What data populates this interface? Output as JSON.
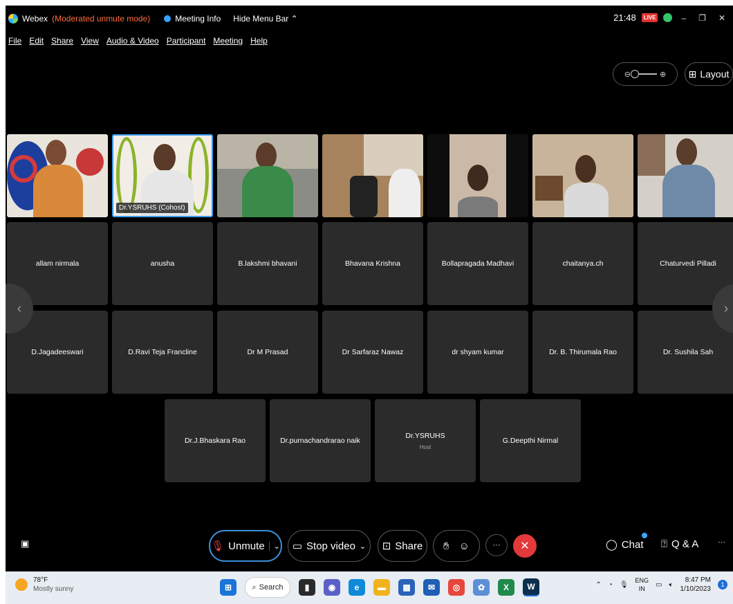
{
  "titlebar": {
    "app_name": "Webex",
    "mode": "(Moderated unmute mode)",
    "meeting_info": "Meeting Info",
    "hide_menu": "Hide Menu Bar ⌃",
    "time": "21:48",
    "rec_badge": "LIVE"
  },
  "menu": [
    "File",
    "Edit",
    "Share",
    "View",
    "Audio & Video",
    "Participant",
    "Meeting",
    "Help"
  ],
  "toolbar": {
    "layout_label": "Layout"
  },
  "video_strip": {
    "host_name_tag": "Dr.YSRUHS (Cohost)"
  },
  "participants": [
    {
      "name": "allam nirmala",
      "role": ""
    },
    {
      "name": "anusha",
      "role": ""
    },
    {
      "name": "B.lakshmi bhavani",
      "role": ""
    },
    {
      "name": "Bhavana Krishna",
      "role": ""
    },
    {
      "name": "Bollapragada Madhavi",
      "role": ""
    },
    {
      "name": "chaitanya.ch",
      "role": ""
    },
    {
      "name": "Chaturvedi Pilladi",
      "role": ""
    },
    {
      "name": "D.Jagadeeswari",
      "role": ""
    },
    {
      "name": "D.Ravi Teja Francline",
      "role": ""
    },
    {
      "name": "Dr M Prasad",
      "role": ""
    },
    {
      "name": "Dr Sarfaraz Nawaz",
      "role": ""
    },
    {
      "name": "dr shyam kumar",
      "role": ""
    },
    {
      "name": "Dr. B. Thirumala Rao",
      "role": ""
    },
    {
      "name": "Dr. Sushila Sah",
      "role": ""
    },
    {
      "name": "Dr.J.Bhaskara Rao",
      "role": ""
    },
    {
      "name": "Dr.purnachandrarao naik",
      "role": ""
    },
    {
      "name": "Dr.YSRUHS",
      "role": "Host"
    },
    {
      "name": "G.Deepthi Nirmal",
      "role": ""
    }
  ],
  "controls": {
    "unmute": "Unmute",
    "stop_video": "Stop video",
    "share": "Share",
    "more": "···",
    "chat": "Chat",
    "qa": "Q & A",
    "overflow": "···"
  },
  "taskbar": {
    "temperature": "78°F",
    "condition": "Mostly sunny",
    "search": "Search",
    "lang_top": "ENG",
    "lang_bottom": "IN",
    "clock_time": "8:47 PM",
    "clock_date": "1/10/2023",
    "notif_count": "1"
  },
  "icons": {
    "webex": "webex-logo-icon",
    "info": "info-icon",
    "zoom_out": "zoom-out-icon",
    "zoom_in": "zoom-in-icon",
    "layout": "grid-icon",
    "caption": "caption-icon",
    "mic_muted": "mic-muted-icon",
    "camera": "camera-icon",
    "share": "share-screen-icon",
    "raise_hand": "raise-hand-icon",
    "reactions": "reaction-icon",
    "end": "close-icon",
    "chat": "chat-bubble-icon",
    "qa": "qa-icon"
  },
  "colors": {
    "background": "#000000",
    "tile": "#2b2b2b",
    "accent": "#3c9df0",
    "end_call": "#e3393a",
    "mode_text": "#ff6b3d"
  }
}
